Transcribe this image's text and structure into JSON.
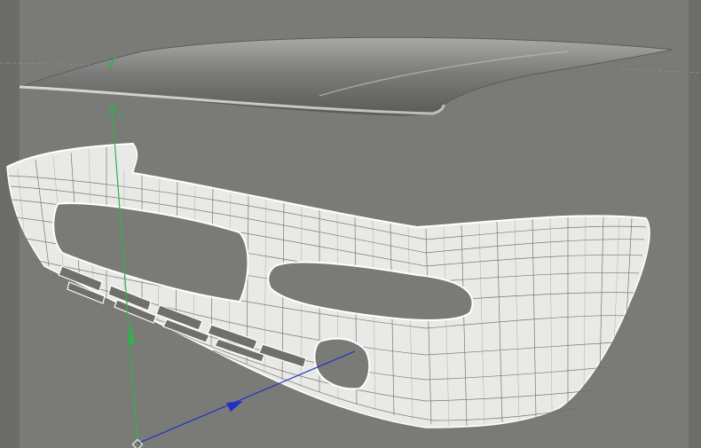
{
  "viewport": {
    "background_color": "#7a7b76",
    "border_color": "#6c6d69",
    "wireframe_color": "#ffffff",
    "hood_color": "#8a8a88",
    "horizon_guide_color": "#7f88a8"
  },
  "gizmo": {
    "y_axis_color": "#2fb34a",
    "x_axis_color": "#2030c8",
    "y_axis_icon": "move-arrow-up-icon",
    "x_axis_icon": "move-arrow-right-icon"
  },
  "objects": [
    {
      "name": "hood",
      "render": "shaded"
    },
    {
      "name": "bumper",
      "render": "wireframe"
    }
  ]
}
